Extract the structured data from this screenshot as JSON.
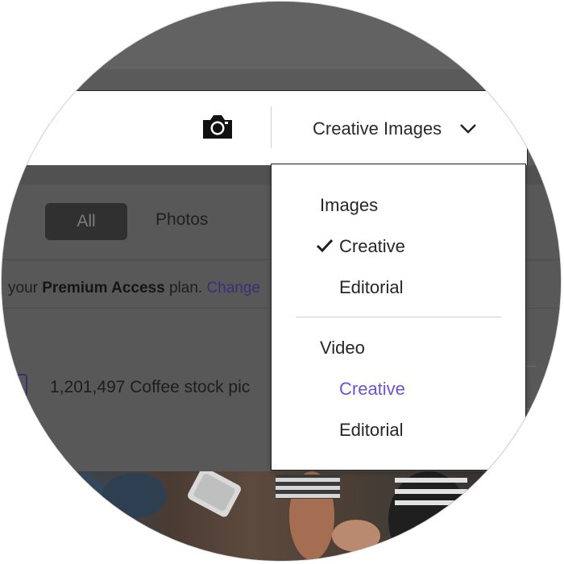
{
  "header": {
    "camera_icon": "camera-icon",
    "type_select": {
      "label": "Creative Images",
      "icon": "chevron-down-icon"
    }
  },
  "filters": {
    "tabs": [
      {
        "label": "All",
        "selected": true
      },
      {
        "label": "Photos",
        "selected": false
      }
    ]
  },
  "notice": {
    "prefix": "your ",
    "plan": "Premium Access",
    "suffix": " plan. ",
    "link": "Change"
  },
  "results": {
    "count_text": "1,201,497 Coffee stock pic"
  },
  "dropdown": {
    "sections": [
      {
        "heading": "Images",
        "items": [
          {
            "label": "Creative",
            "checked": true,
            "active": false
          },
          {
            "label": "Editorial",
            "checked": false,
            "active": false
          }
        ]
      },
      {
        "heading": "Video",
        "items": [
          {
            "label": "Creative",
            "checked": false,
            "active": true
          },
          {
            "label": "Editorial",
            "checked": false,
            "active": false
          }
        ]
      }
    ]
  },
  "colors": {
    "accent": "#6e53d0",
    "link": "#3b2f7a",
    "overlay": "#5d5d5d"
  }
}
